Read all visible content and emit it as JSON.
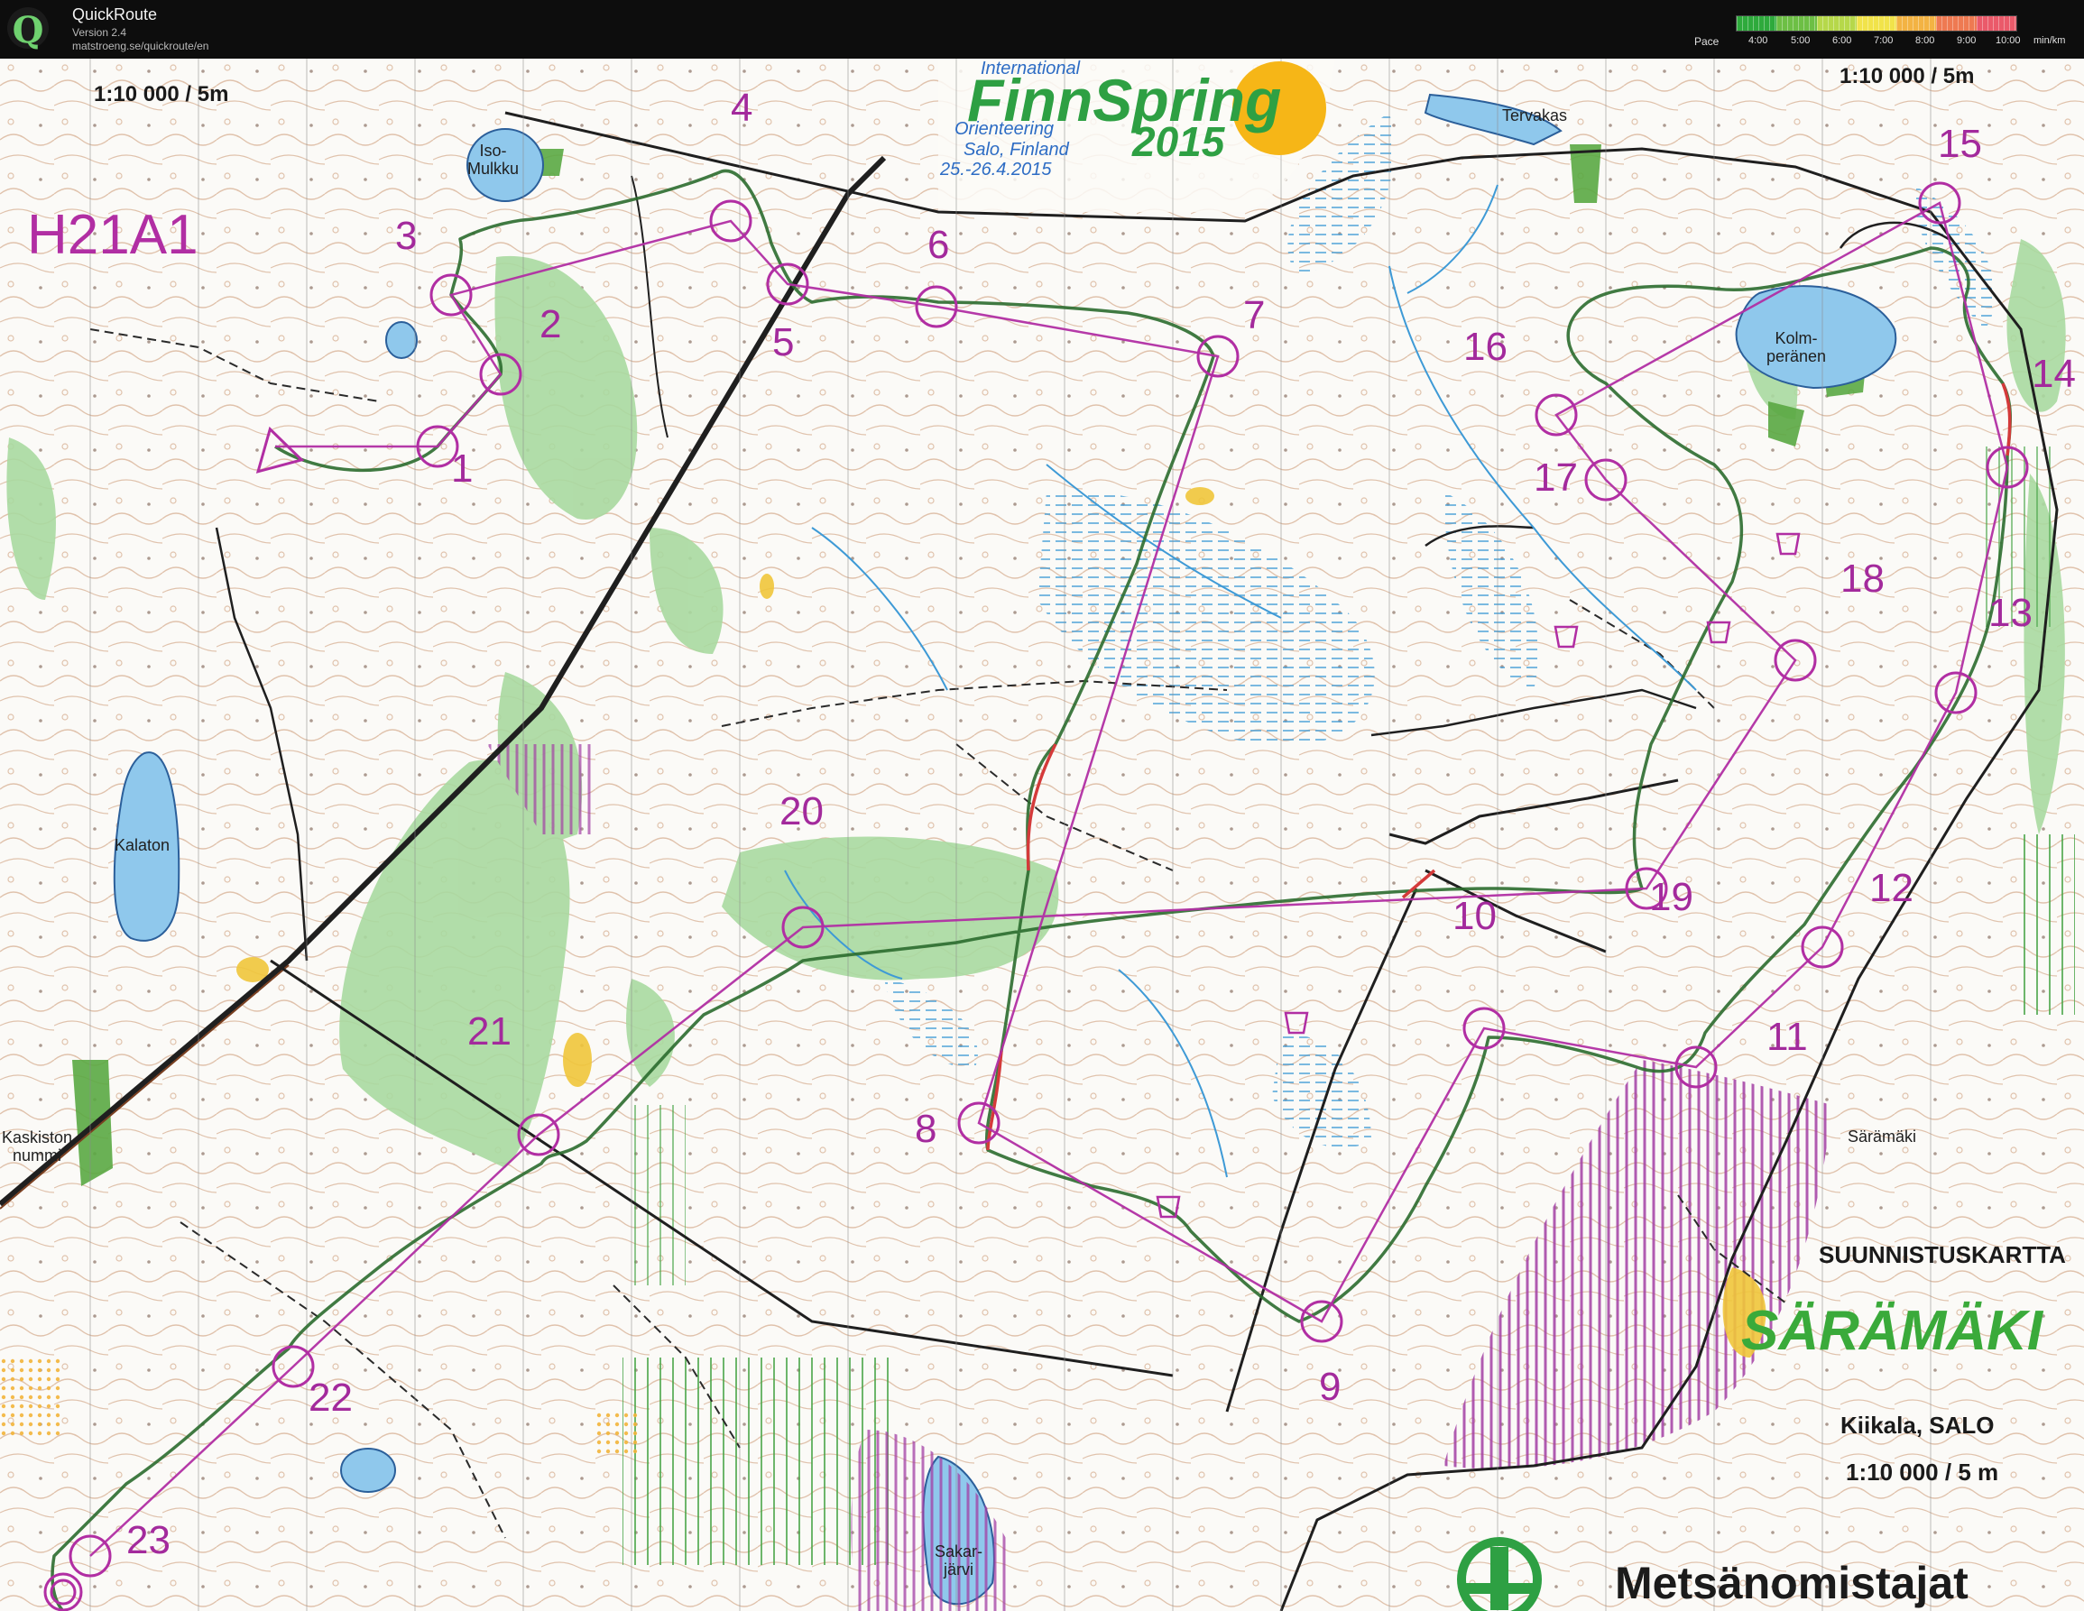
{
  "window": {
    "app_name": "QuickRoute",
    "version": "Version 2.4",
    "url": "matstroeng.se/quickroute/en",
    "icon": "quickroute-q-icon"
  },
  "pace_legend": {
    "label": "Pace",
    "ticks": [
      "4:00",
      "5:00",
      "6:00",
      "7:00",
      "8:00",
      "9:00",
      "10:00"
    ],
    "unit": "min/km",
    "colors": [
      "#2eaa3c",
      "#6dbf45",
      "#b6d84a",
      "#f1e34a",
      "#f3b343",
      "#ee7a52",
      "#ea5a6a"
    ]
  },
  "map": {
    "scale_left": "1:10 000 / 5m",
    "scale_right": "1:10 000 / 5m",
    "course": "H21A1",
    "event": {
      "international": "International",
      "name": "FinnSpring",
      "orienteering": "Orienteering",
      "year": "2015",
      "place": "Salo, Finland",
      "dates": "25.-26.4.2015"
    },
    "place_names": {
      "iso_mulkku_1": "Iso-",
      "iso_mulkku_2": "Mulkku",
      "kalaton": "Kalaton",
      "kaskisto_1": "Kaskiston",
      "kaskisto_2": "nummi",
      "tervakas": "Tervakas",
      "kolmperanen_1": "Kolm-",
      "kolmperanen_2": "peränen",
      "saramaki": "Särämäki",
      "sakarjarvi_1": "Sakar-",
      "sakarjarvi_2": "järvi"
    },
    "map_info": {
      "heading": "SUUNNISTUSKARTTA",
      "title": "SÄRÄMÄKI",
      "location": "Kiikala, SALO",
      "scale": "1:10 000 / 5 m"
    },
    "publisher": "Metsänomistajat",
    "controls": [
      {
        "label": "1"
      },
      {
        "label": "2"
      },
      {
        "label": "3"
      },
      {
        "label": "4"
      },
      {
        "label": "5"
      },
      {
        "label": "6"
      },
      {
        "label": "7"
      },
      {
        "label": "8"
      },
      {
        "label": "9"
      },
      {
        "label": "10"
      },
      {
        "label": "11"
      },
      {
        "label": "12"
      },
      {
        "label": "13"
      },
      {
        "label": "14"
      },
      {
        "label": "15"
      },
      {
        "label": "16"
      },
      {
        "label": "17"
      },
      {
        "label": "18"
      },
      {
        "label": "19"
      },
      {
        "label": "20"
      },
      {
        "label": "21"
      },
      {
        "label": "22"
      },
      {
        "label": "23"
      }
    ],
    "colors": {
      "course_magenta": "#b12ea3",
      "water": "#8fc8ec",
      "forest_green": "#a8d8a0",
      "route": "#2e6b2e",
      "contour": "#a0623a"
    }
  }
}
